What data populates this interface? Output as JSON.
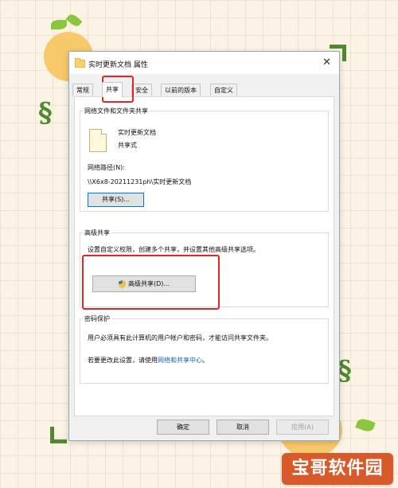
{
  "dialog": {
    "title": "实时更新文档 属性",
    "close_symbol": "✕",
    "tabs": [
      {
        "label": "常规"
      },
      {
        "label": "共享",
        "active": true
      },
      {
        "label": "安全"
      },
      {
        "label": "以前的版本"
      },
      {
        "label": "自定义"
      }
    ]
  },
  "sharing_group": {
    "title": "网络文件和文件夹共享",
    "folder_name": "实时更新文档",
    "folder_status": "共享式",
    "path_label": "网络路径(N):",
    "path_value": "\\\\X6x8-20211231ph\\实时更新文档",
    "share_button": "共享(S)..."
  },
  "advanced_group": {
    "title": "高级共享",
    "description": "设置自定义权限，创建多个共享，并设置其他高级共享选项。",
    "advanced_button": "高级共享(D)..."
  },
  "password_group": {
    "title": "密码保护",
    "line1": "用户必须具有此计算机的用户帐户和密码，才能访问共享文件夹。",
    "line2_prefix": "若要更改此设置，请使用",
    "line2_link": "网络和共享中心",
    "line2_suffix": "。"
  },
  "footer": {
    "ok": "确定",
    "cancel": "取消",
    "apply": "应用(A)"
  },
  "watermark": {
    "text": "宝哥软件园"
  },
  "colors": {
    "highlight_red": "#e0262b",
    "link_blue": "#1b5fb7",
    "accent_green": "#4f8a2e"
  }
}
